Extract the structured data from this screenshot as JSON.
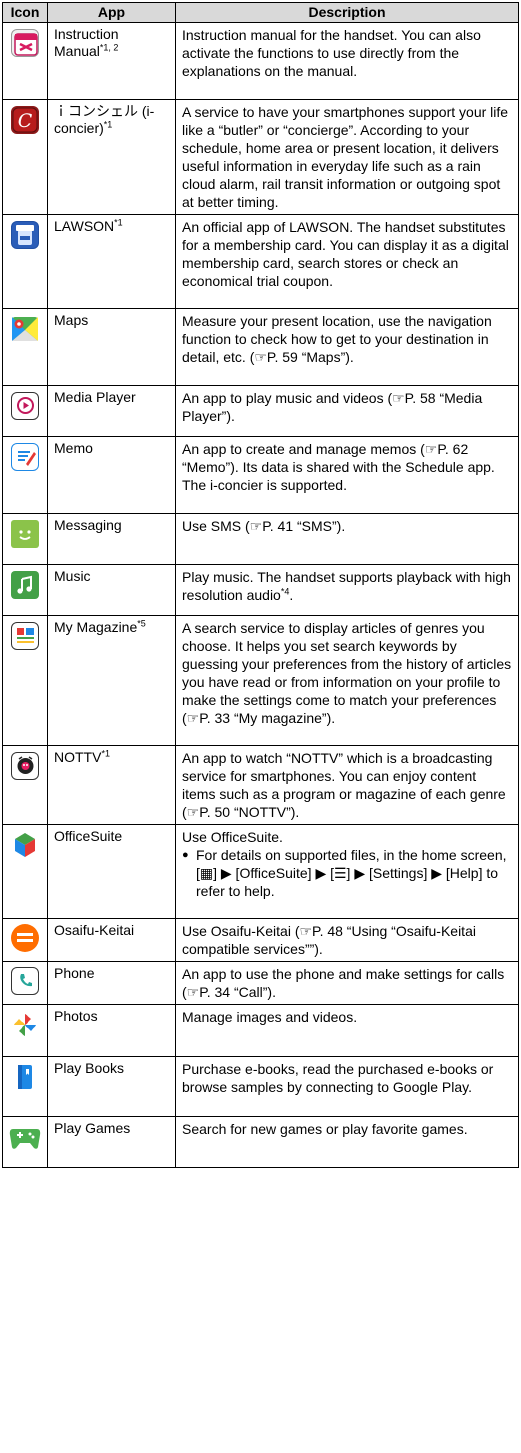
{
  "header": {
    "icon": "Icon",
    "app": "App",
    "description": "Description"
  },
  "rows": [
    {
      "name": "Instruction Manual",
      "sup": "*1, 2",
      "icon": "instruction-manual-icon",
      "desc": "Instruction manual for the handset. You can also activate the functions to use directly from the explanations on the manual."
    },
    {
      "name": "ｉコンシェル (i-concier)",
      "sup": "*1",
      "icon": "iconcier-icon",
      "desc": "A service to have your smartphones support your life like a “butler” or “concierge”. According to your schedule, home area or present location, it delivers useful information in everyday life such as a rain cloud alarm, rail transit information or outgoing spot at better timing."
    },
    {
      "name": "LAWSON",
      "sup": "*1",
      "icon": "lawson-icon",
      "desc": "An official app of LAWSON. The handset substitutes for a membership card. You can display it as a digital membership card, search stores or check an economical trial coupon."
    },
    {
      "name": "Maps",
      "sup": "",
      "icon": "maps-icon",
      "desc": "Measure your present location, use the navigation function to check how to get to your destination in detail, etc. (☞P. 59 “Maps”)."
    },
    {
      "name": "Media Player",
      "sup": "",
      "icon": "media-player-icon",
      "desc": "An app to play music and videos (☞P. 58 “Media Player”)."
    },
    {
      "name": "Memo",
      "sup": "",
      "icon": "memo-icon",
      "desc": "An app to create and manage memos (☞P. 62 “Memo”). Its data is shared with the Schedule app. The i-concier is supported."
    },
    {
      "name": "Messaging",
      "sup": "",
      "icon": "messaging-icon",
      "desc": "Use SMS (☞P. 41 “SMS”)."
    },
    {
      "name": "Music",
      "sup": "",
      "icon": "music-icon",
      "desc": "Play music. The handset supports playback with high resolution audio",
      "desc_sup": "*4",
      "desc_end": "."
    },
    {
      "name": "My Magazine",
      "sup": "*5",
      "icon": "my-magazine-icon",
      "desc": "A search service to display articles of genres you choose. It helps you set search keywords by guessing your preferences from the history of articles you have read or from information on your profile to make the settings come to match your preferences (☞P. 33 “My magazine”)."
    },
    {
      "name": "NOTTV",
      "sup": "*1",
      "icon": "nottv-icon",
      "desc": "An app to watch “NOTTV” which is a broadcasting service for smartphones. You can enjoy content items such as a program or magazine of each genre (☞P. 50 “NOTTV”)."
    },
    {
      "name": "OfficeSuite",
      "sup": "",
      "icon": "officesuite-icon",
      "desc": "Use OfficeSuite.",
      "bullet": "For details on supported files, in the home screen, [▦] ▶ [OfficeSuite] ▶ [☰] ▶ [Settings] ▶ [Help] to refer to help."
    },
    {
      "name": "Osaifu-Keitai",
      "sup": "",
      "icon": "osaifu-keitai-icon",
      "desc": "Use Osaifu-Keitai (☞P. 48 “Using “Osaifu-Keitai compatible services””)."
    },
    {
      "name": "Phone",
      "sup": "",
      "icon": "phone-icon",
      "desc": "An app to use the phone and make settings for calls (☞P. 34 “Call”)."
    },
    {
      "name": "Photos",
      "sup": "",
      "icon": "photos-icon",
      "desc": "Manage images and videos."
    },
    {
      "name": "Play Books",
      "sup": "",
      "icon": "play-books-icon",
      "desc": "Purchase e-books, read the purchased e-books or browse samples by connecting to Google Play."
    },
    {
      "name": "Play Games",
      "sup": "",
      "icon": "play-games-icon",
      "desc": "Search for new games or play favorite games."
    }
  ],
  "icon_labels": {
    "instruction_manual": "取扱説明書",
    "lawson": "LAWSON STATION",
    "osaifu": "おサイフケータイ"
  },
  "colors": {
    "header_bg": "#d9d9d9",
    "border": "#000000"
  }
}
